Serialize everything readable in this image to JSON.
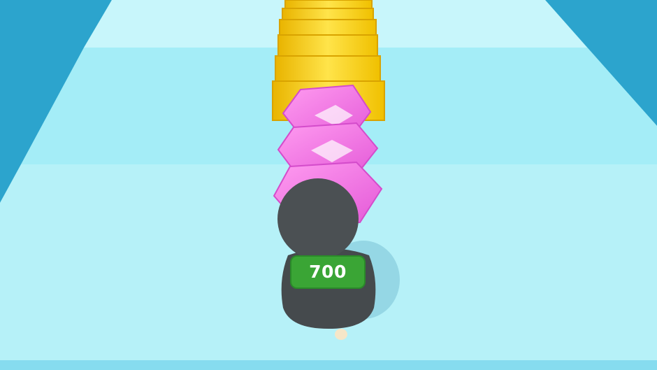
{
  "hud": {
    "score": "700"
  },
  "colors": {
    "sky_water": "#2aa7cf",
    "track_light": "#bff4fb",
    "track_mid": "#8fe6f4",
    "gold": "#f7cf1f",
    "gem": "#f07ce6",
    "character": "#4a4f52",
    "badge": "#3fae3a"
  },
  "scene": {
    "track_icon": "runner-track",
    "gold_icon": "gold-bar-stack",
    "gem_icon": "pink-gem",
    "character_icon": "runner-character"
  }
}
